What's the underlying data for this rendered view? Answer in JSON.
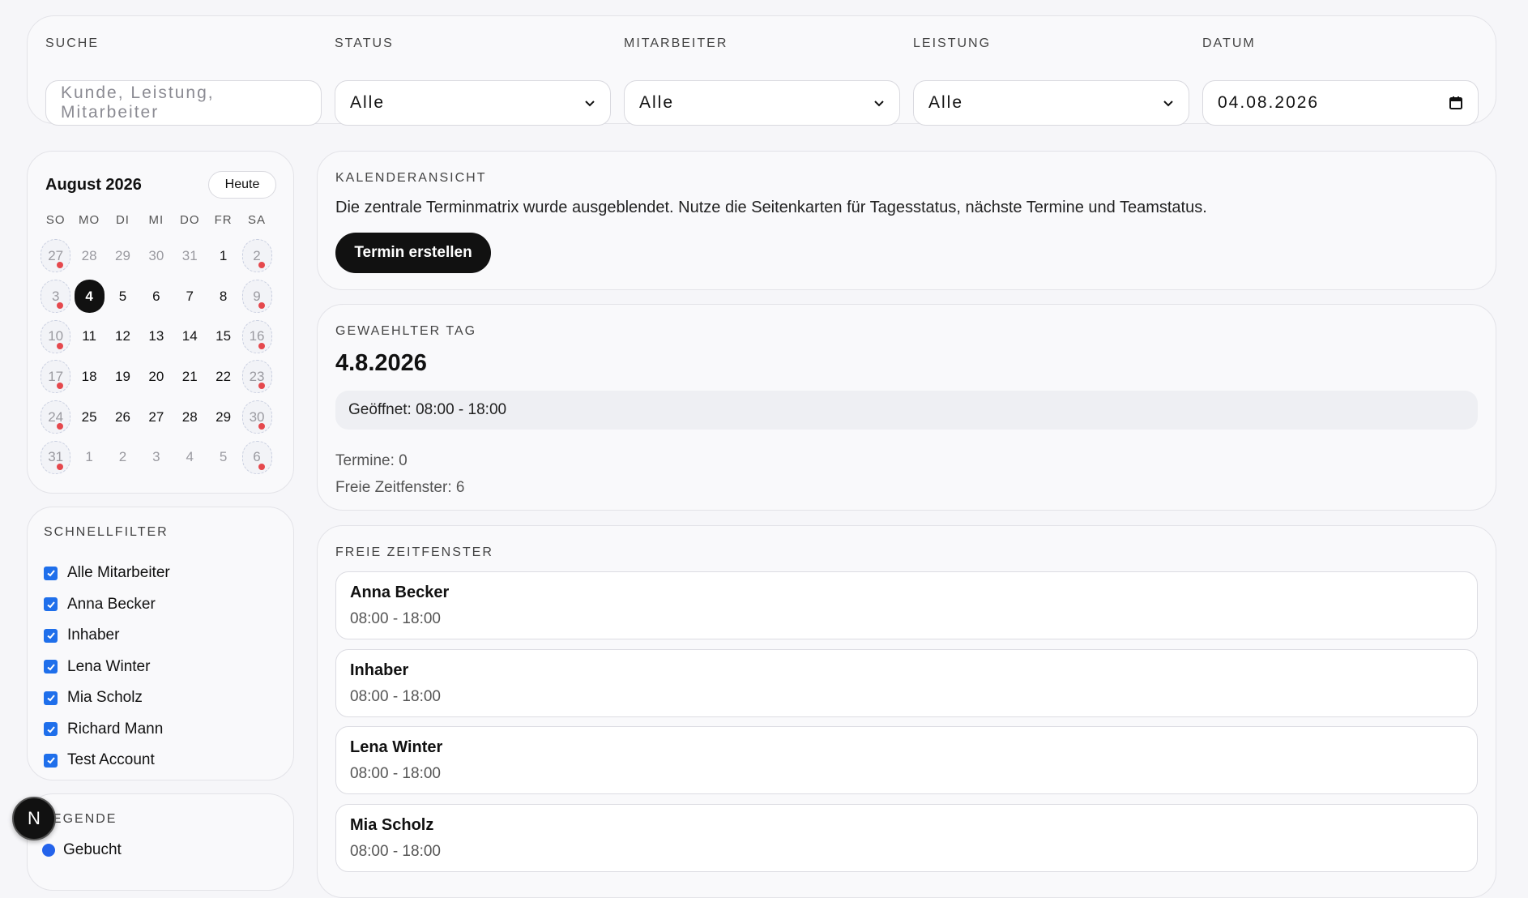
{
  "filters": {
    "search": {
      "label": "SUCHE",
      "placeholder": "Kunde, Leistung, Mitarbeiter"
    },
    "status": {
      "label": "STATUS",
      "value": "Alle"
    },
    "employee": {
      "label": "MITARBEITER",
      "value": "Alle"
    },
    "service": {
      "label": "LEISTUNG",
      "value": "Alle"
    },
    "date": {
      "label": "DATUM",
      "value": "04.08.2026"
    }
  },
  "mini_calendar": {
    "title": "August 2026",
    "today_label": "Heute",
    "weekdays": [
      "SO",
      "MO",
      "DI",
      "MI",
      "DO",
      "FR",
      "SA"
    ],
    "weeks": [
      [
        {
          "d": "27",
          "t": "out closed"
        },
        {
          "d": "28",
          "t": "out"
        },
        {
          "d": "29",
          "t": "out"
        },
        {
          "d": "30",
          "t": "out"
        },
        {
          "d": "31",
          "t": "out"
        },
        {
          "d": "1",
          "t": "in"
        },
        {
          "d": "2",
          "t": "closed"
        }
      ],
      [
        {
          "d": "3",
          "t": "closed"
        },
        {
          "d": "4",
          "t": "selected"
        },
        {
          "d": "5",
          "t": "in"
        },
        {
          "d": "6",
          "t": "in"
        },
        {
          "d": "7",
          "t": "in"
        },
        {
          "d": "8",
          "t": "in"
        },
        {
          "d": "9",
          "t": "closed"
        }
      ],
      [
        {
          "d": "10",
          "t": "closed"
        },
        {
          "d": "11",
          "t": "in"
        },
        {
          "d": "12",
          "t": "in"
        },
        {
          "d": "13",
          "t": "in"
        },
        {
          "d": "14",
          "t": "in"
        },
        {
          "d": "15",
          "t": "in"
        },
        {
          "d": "16",
          "t": "closed"
        }
      ],
      [
        {
          "d": "17",
          "t": "closed"
        },
        {
          "d": "18",
          "t": "in"
        },
        {
          "d": "19",
          "t": "in"
        },
        {
          "d": "20",
          "t": "in"
        },
        {
          "d": "21",
          "t": "in"
        },
        {
          "d": "22",
          "t": "in"
        },
        {
          "d": "23",
          "t": "closed"
        }
      ],
      [
        {
          "d": "24",
          "t": "closed"
        },
        {
          "d": "25",
          "t": "in"
        },
        {
          "d": "26",
          "t": "in"
        },
        {
          "d": "27",
          "t": "in"
        },
        {
          "d": "28",
          "t": "in"
        },
        {
          "d": "29",
          "t": "in"
        },
        {
          "d": "30",
          "t": "closed"
        }
      ],
      [
        {
          "d": "31",
          "t": "closed"
        },
        {
          "d": "1",
          "t": "out"
        },
        {
          "d": "2",
          "t": "out"
        },
        {
          "d": "3",
          "t": "out"
        },
        {
          "d": "4",
          "t": "out"
        },
        {
          "d": "5",
          "t": "out"
        },
        {
          "d": "6",
          "t": "out closed"
        }
      ]
    ]
  },
  "quick_filter": {
    "title": "SCHNELLFILTER",
    "items": [
      "Alle Mitarbeiter",
      "Anna Becker",
      "Inhaber",
      "Lena Winter",
      "Mia Scholz",
      "Richard Mann",
      "Test Account"
    ]
  },
  "legend": {
    "title": "LEGENDE",
    "item": "Gebucht"
  },
  "calendar_view": {
    "label": "KALENDERANSICHT",
    "description": "Die zentrale Terminmatrix wurde ausgeblendet. Nutze die Seitenkarten für Tagesstatus, nächste Termine und Teamstatus.",
    "create_label": "Termin erstellen"
  },
  "selected_day": {
    "label": "GEWAEHLTER TAG",
    "date": "4.8.2026",
    "opening": "Geöffnet: 08:00 - 18:00",
    "appointments": "Termine: 0",
    "free_slots": "Freie Zeitfenster: 6"
  },
  "free_windows": {
    "label": "FREIE ZEITFENSTER",
    "slots": [
      {
        "name": "Anna Becker",
        "time": "08:00 - 18:00"
      },
      {
        "name": "Inhaber",
        "time": "08:00 - 18:00"
      },
      {
        "name": "Lena Winter",
        "time": "08:00 - 18:00"
      },
      {
        "name": "Mia Scholz",
        "time": "08:00 - 18:00"
      }
    ]
  },
  "fab": {
    "label": "N"
  },
  "colors": {
    "accent": "#111111",
    "checkbox": "#1f6feb",
    "closed_dot": "#e5484d",
    "booked": "#2463eb"
  }
}
